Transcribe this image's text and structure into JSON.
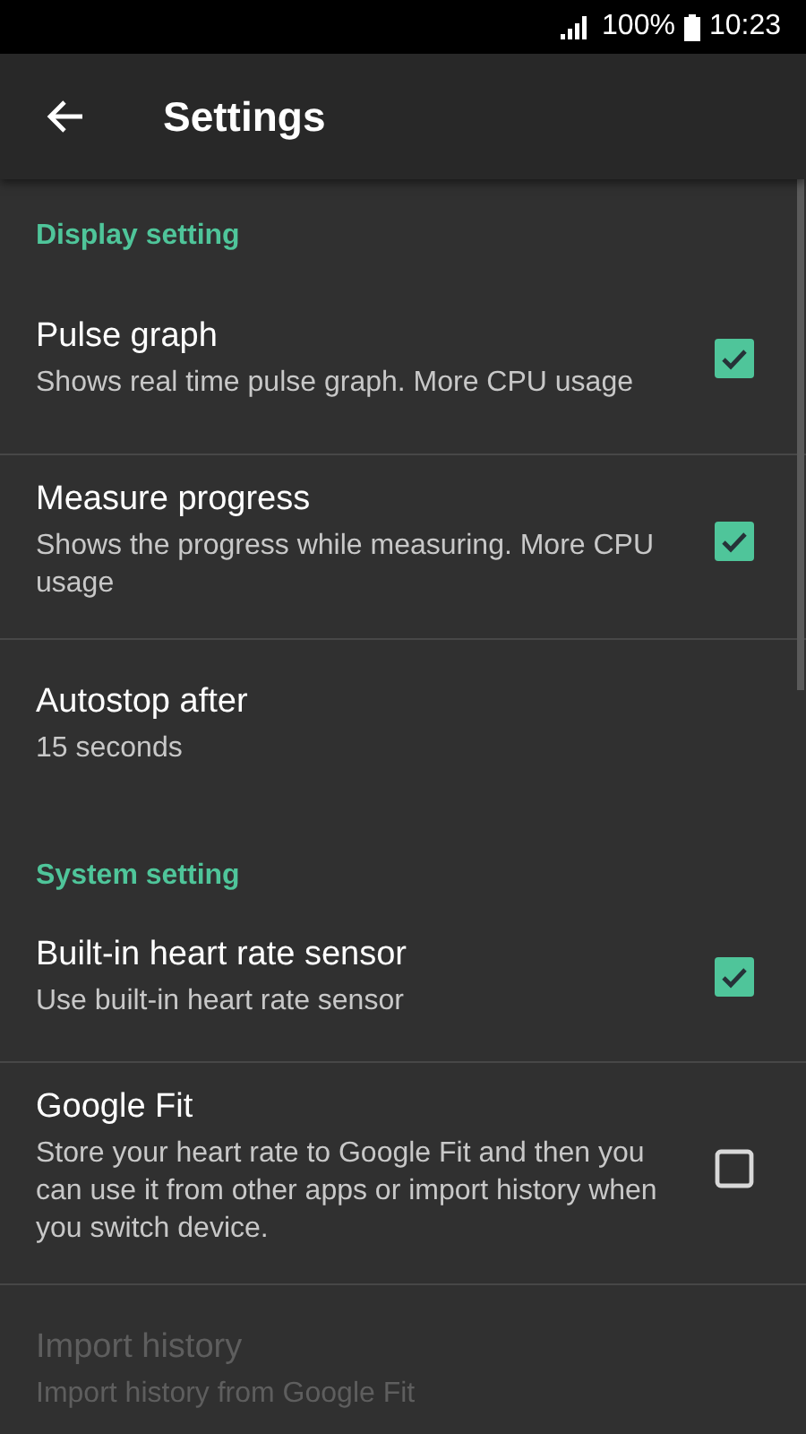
{
  "status_bar": {
    "battery": "100%",
    "time": "10:23"
  },
  "app_bar": {
    "title": "Settings"
  },
  "sections": [
    {
      "header": "Display setting",
      "items": [
        {
          "kind": "checkbox",
          "title": "Pulse graph",
          "summary": "Shows real time pulse graph. More CPU usage",
          "checked": true,
          "disabled": false
        },
        {
          "kind": "checkbox",
          "title": "Measure progress",
          "summary": "Shows the progress while measuring. More CPU usage",
          "checked": true,
          "disabled": false
        },
        {
          "kind": "plain",
          "title": "Autostop after",
          "summary": "15 seconds",
          "disabled": false
        }
      ]
    },
    {
      "header": "System setting",
      "items": [
        {
          "kind": "checkbox",
          "title": "Built-in heart rate sensor",
          "summary": "Use built-in heart rate sensor",
          "checked": true,
          "disabled": false
        },
        {
          "kind": "checkbox",
          "title": "Google Fit",
          "summary": "Store your heart rate to Google Fit and then you can use it from other apps or import history when you switch device.",
          "checked": false,
          "disabled": false
        },
        {
          "kind": "plain",
          "title": "Import history",
          "summary": "Import history from Google Fit",
          "disabled": true
        }
      ]
    }
  ]
}
